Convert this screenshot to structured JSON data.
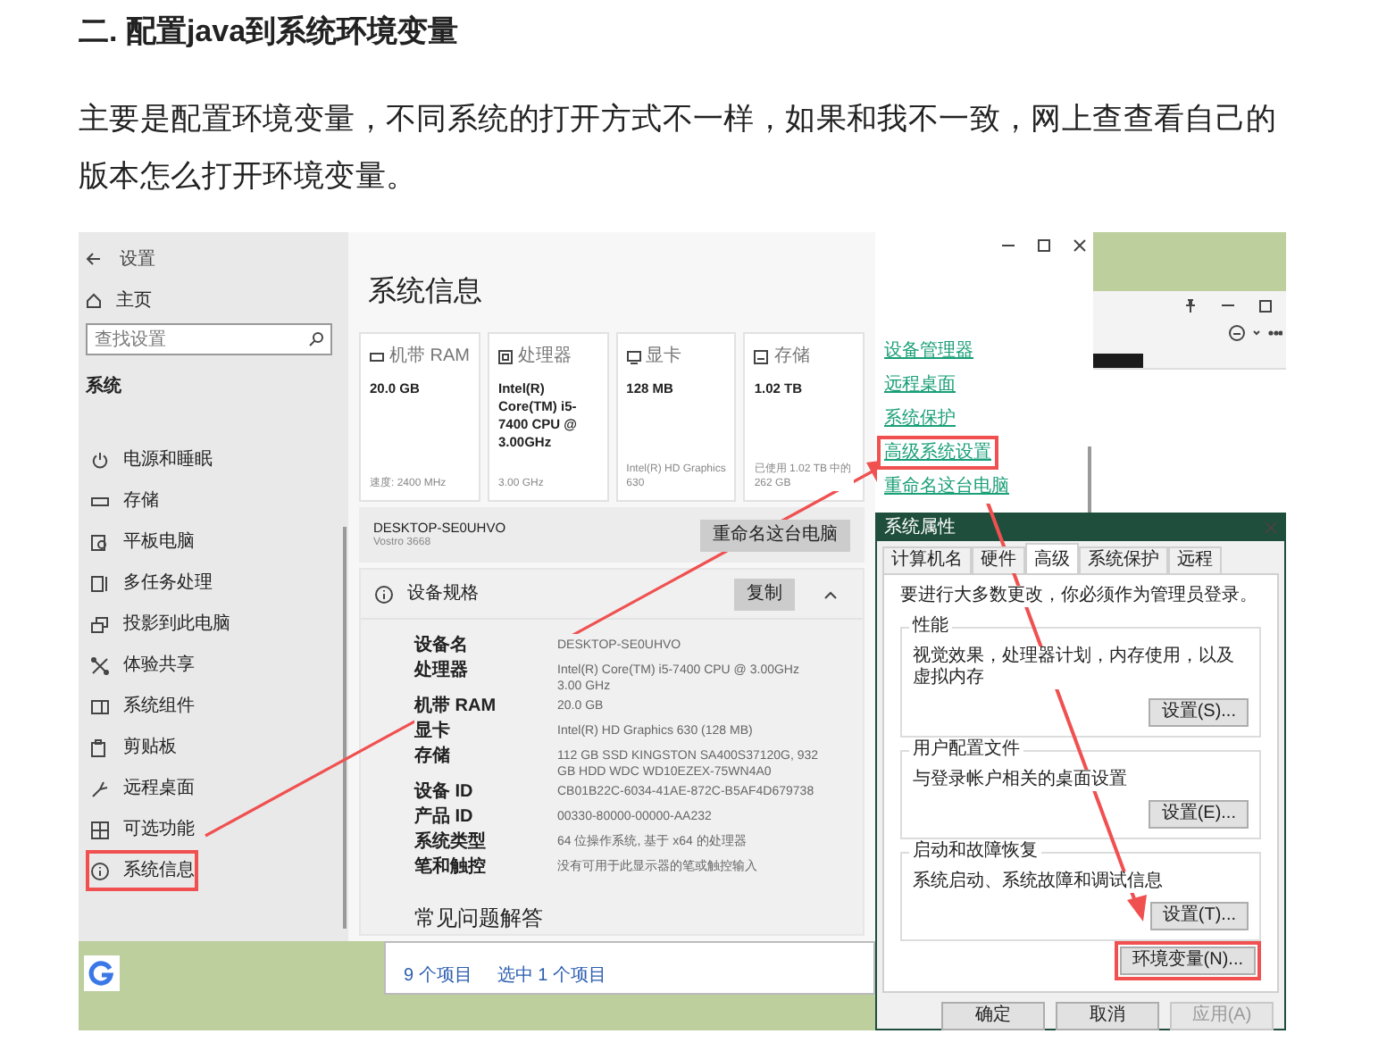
{
  "article": {
    "heading": "二. 配置java到系统环境变量",
    "paragraph": "主要是配置环境变量，不同系统的打开方式不一样，如果和我不一致，网上查查看自己的版本怎么打开环境变量。"
  },
  "settings_window": {
    "title": "设置",
    "home": "主页",
    "search_placeholder": "查找设置",
    "section": "系统",
    "nav_items": [
      {
        "label": "电源和睡眠",
        "annotated": false
      },
      {
        "label": "存储",
        "annotated": false
      },
      {
        "label": "平板电脑",
        "annotated": false
      },
      {
        "label": "多任务处理",
        "annotated": false
      },
      {
        "label": "投影到此电脑",
        "annotated": false
      },
      {
        "label": "体验共享",
        "annotated": false
      },
      {
        "label": "系统组件",
        "annotated": false
      },
      {
        "label": "剪贴板",
        "annotated": false
      },
      {
        "label": "远程桌面",
        "annotated": false
      },
      {
        "label": "可选功能",
        "annotated": false
      },
      {
        "label": "系统信息",
        "annotated": true
      }
    ],
    "page_title": "系统信息",
    "cards": [
      {
        "label": "机带 RAM",
        "value": "20.0 GB",
        "footnote": "速度: 2400 MHz"
      },
      {
        "label": "处理器",
        "value": "Intel(R) Core(TM) i5-7400 CPU @ 3.00GHz",
        "footnote": "3.00 GHz"
      },
      {
        "label": "显卡",
        "value": "128 MB",
        "footnote": "Intel(R) HD Graphics 630"
      },
      {
        "label": "存储",
        "value": "1.02 TB",
        "footnote": "已使用 1.02 TB 中的 262 GB"
      }
    ],
    "device_name": "DESKTOP-SE0UHVO",
    "model": "Vostro 3668",
    "rename_button": "重命名这台电脑",
    "specs": {
      "title": "设备规格",
      "copy_button": "复制",
      "expanded": true,
      "rows": [
        {
          "label": "设备名",
          "value": "DESKTOP-SE0UHVO"
        },
        {
          "label": "处理器",
          "value": "Intel(R) Core(TM) i5-7400 CPU @ 3.00GHz   3.00 GHz"
        },
        {
          "label": "机带 RAM",
          "value": "20.0 GB"
        },
        {
          "label": "显卡",
          "value": "Intel(R) HD Graphics 630 (128 MB)"
        },
        {
          "label": "存储",
          "value": "112 GB SSD KINGSTON SA400S37120G, 932 GB HDD WDC WD10EZEX-75WN4A0"
        },
        {
          "label": "设备 ID",
          "value": "CB01B22C-6034-41AE-872C-B5AF4D679738"
        },
        {
          "label": "产品 ID",
          "value": "00330-80000-00000-AA232"
        },
        {
          "label": "系统类型",
          "value": "64 位操作系统, 基于 x64 的处理器"
        },
        {
          "label": "笔和触控",
          "value": "没有可用于此显示器的笔或触控输入"
        }
      ]
    },
    "faq_title": "常见问题解答",
    "related_links": [
      {
        "label": "设备管理器",
        "annotated": false
      },
      {
        "label": "远程桌面",
        "annotated": false
      },
      {
        "label": "系统保护",
        "annotated": false
      },
      {
        "label": "高级系统设置",
        "annotated": true
      },
      {
        "label": "重命名这台电脑",
        "annotated": false
      }
    ]
  },
  "explorer_status": [
    "9 个项目",
    "选中 1 个项目"
  ],
  "dialog": {
    "title": "系统属性",
    "tabs": [
      {
        "label": "计算机名",
        "selected": false
      },
      {
        "label": "硬件",
        "selected": false
      },
      {
        "label": "高级",
        "selected": true
      },
      {
        "label": "系统保护",
        "selected": false
      },
      {
        "label": "远程",
        "selected": false
      }
    ],
    "intro": "要进行大多数更改，你必须作为管理员登录。",
    "groups": [
      {
        "title": "性能",
        "description": "视觉效果，处理器计划，内存使用，以及虚拟内存",
        "button": "设置(S)..."
      },
      {
        "title": "用户配置文件",
        "description": "与登录帐户相关的桌面设置",
        "button": "设置(E)..."
      },
      {
        "title": "启动和故障恢复",
        "description": "系统启动、系统故障和调试信息",
        "button": "设置(T)..."
      }
    ],
    "env_button": {
      "label": "环境变量(N)...",
      "annotated": true
    },
    "buttons": [
      {
        "label": "确定",
        "disabled": false
      },
      {
        "label": "取消",
        "disabled": false
      },
      {
        "label": "应用(A)",
        "disabled": true
      }
    ]
  }
}
